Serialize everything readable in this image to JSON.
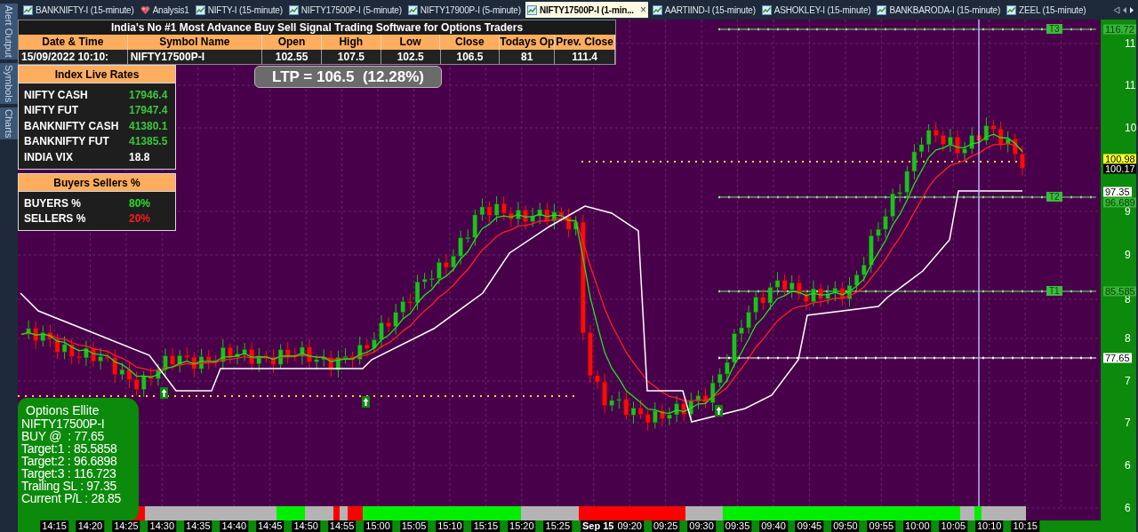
{
  "side_rail": [
    {
      "label": "Alert Output"
    },
    {
      "label": "Symbols"
    },
    {
      "label": "Charts"
    }
  ],
  "tabs": [
    {
      "label": "BANKNIFTY-I (15-minute)",
      "kind": "chart",
      "selected": false
    },
    {
      "label": "Analysis1",
      "kind": "analysis",
      "selected": false
    },
    {
      "label": "NIFTY-I (15-minute)",
      "kind": "chart",
      "selected": false
    },
    {
      "label": "NIFTY17500P-I (5-minute)",
      "kind": "chart",
      "selected": false
    },
    {
      "label": "NIFTY17900P-I (5-minute)",
      "kind": "chart",
      "selected": false
    },
    {
      "label": "NIFTY17500P-I (1-min...",
      "kind": "chart",
      "selected": true,
      "close": "×"
    },
    {
      "label": "AARTIIND-I (15-minute)",
      "kind": "chart",
      "selected": false
    },
    {
      "label": "ASHOKLEY-I (15-minute)",
      "kind": "chart",
      "selected": false
    },
    {
      "label": "BANKBARODA-I (15-minute)",
      "kind": "chart",
      "selected": false
    },
    {
      "label": "ZEEL (15-minute)",
      "kind": "chart",
      "selected": false
    }
  ],
  "quote_table": {
    "title": "India's No #1 Most Advance Buy Sell Signal Trading Software for Options Traders",
    "columns": [
      "Date & Time",
      "Symbol Name",
      "Open",
      "High",
      "Low",
      "Close",
      "Todays Op",
      "Prev. Close"
    ],
    "row": [
      "15/09/2022 10:10:",
      "NIFTY17500P-I",
      "102.55",
      "107.5",
      "102.5",
      "106.5",
      "81",
      "111.4"
    ]
  },
  "ltp": "LTP = 106.5  (12.28%)",
  "index_live_rates": {
    "title": "Index Live Rates",
    "rows": [
      {
        "name": "NIFTY CASH",
        "value": "17946.4",
        "color": "#3cc83c"
      },
      {
        "name": "NIFTY FUT",
        "value": "17947.4",
        "color": "#3cc83c"
      },
      {
        "name": "BANKNIFTY CASH",
        "value": "41380.1",
        "color": "#3cc83c"
      },
      {
        "name": "BANKNIFTY FUT",
        "value": "41385.5",
        "color": "#3cc83c"
      },
      {
        "name": "INDIA VIX",
        "value": "18.8",
        "color": "#ffffff"
      }
    ]
  },
  "buyers_sellers": {
    "title": "Buyers Sellers %",
    "rows": [
      {
        "name": "BUYERS %",
        "value": "80%",
        "color": "#22e022"
      },
      {
        "name": "SELLERS %",
        "value": "20%",
        "color": "#ff1a1a"
      }
    ]
  },
  "signal_box": {
    "title": "Options Ellite",
    "lines": [
      "NIFTY17500P-I",
      "BUY @  : 77.65",
      "Target:1 : 85.5858",
      "Target:2 : 96.6898",
      "Target:3 : 116.723",
      "Trailing SL : 97.35",
      "Current P/L : 28.85"
    ]
  },
  "target_lines": [
    {
      "label": "T3"
    },
    {
      "label": "T2"
    },
    {
      "label": "T1"
    }
  ],
  "price_axis": {
    "ticks": [
      "11",
      "11",
      "10",
      "9",
      "9",
      "8",
      "8",
      "7",
      "7",
      "6",
      "6"
    ],
    "tags": [
      {
        "label": "116.72",
        "kind": "target"
      },
      {
        "label": "100.98",
        "kind": "level"
      },
      {
        "label": "100.17",
        "kind": "last"
      },
      {
        "label": "97.35",
        "kind": "stop"
      },
      {
        "label": "96.689",
        "kind": "target"
      },
      {
        "label": "85.585",
        "kind": "target"
      },
      {
        "label": "77.65",
        "kind": "stop"
      }
    ]
  },
  "time_axis": [
    {
      "label": "14:15",
      "kind": "time"
    },
    {
      "label": "14:20",
      "kind": "time"
    },
    {
      "label": "14:25",
      "kind": "time"
    },
    {
      "label": "14:30",
      "kind": "time"
    },
    {
      "label": "14:35",
      "kind": "time"
    },
    {
      "label": "14:40",
      "kind": "time"
    },
    {
      "label": "14:45",
      "kind": "time"
    },
    {
      "label": "14:50",
      "kind": "time"
    },
    {
      "label": "14:55",
      "kind": "time"
    },
    {
      "label": "15:00",
      "kind": "time"
    },
    {
      "label": "15:05",
      "kind": "time"
    },
    {
      "label": "15:10",
      "kind": "time"
    },
    {
      "label": "15:15",
      "kind": "time"
    },
    {
      "label": "15:20",
      "kind": "time"
    },
    {
      "label": "15:25",
      "kind": "time"
    },
    {
      "label": "Sep 15",
      "kind": "date"
    },
    {
      "label": "09:20",
      "kind": "time"
    },
    {
      "label": "09:25",
      "kind": "time"
    },
    {
      "label": "09:30",
      "kind": "time"
    },
    {
      "label": "09:35",
      "kind": "time"
    },
    {
      "label": "09:40",
      "kind": "time"
    },
    {
      "label": "09:45",
      "kind": "time"
    },
    {
      "label": "09:50",
      "kind": "time"
    },
    {
      "label": "09:55",
      "kind": "time"
    },
    {
      "label": "10:00",
      "kind": "time"
    },
    {
      "label": "10:05",
      "kind": "time"
    },
    {
      "label": "10:10",
      "kind": "time"
    },
    {
      "label": "10:15",
      "kind": "time"
    }
  ]
}
